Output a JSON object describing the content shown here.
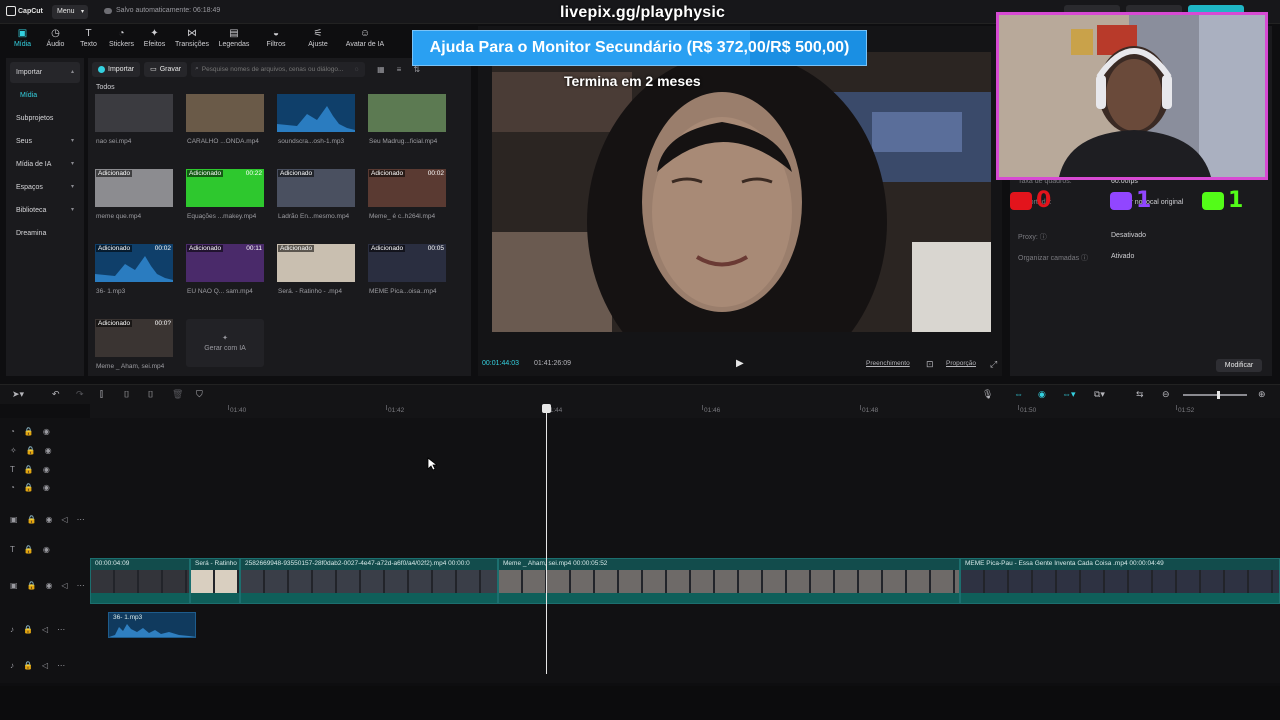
{
  "app": {
    "logo": "CapCut",
    "menu_label": "Menu",
    "autosave": "Salvo automaticamente: 06:18:49"
  },
  "overlay": {
    "stream_url": "livepix.gg/playphysic",
    "goal_text": "Ajuda Para o Monitor Secundário (R$ 372,00/R$ 500,00)",
    "goal_progress": 0.744,
    "goal_subtitle": "Termina em 2 meses",
    "counters": [
      {
        "platform": "youtube-icon",
        "value": "0",
        "color": "#e3141c"
      },
      {
        "platform": "twitch-icon",
        "value": "1",
        "color": "#9146ff"
      },
      {
        "platform": "kick-icon",
        "value": "1",
        "color": "#53fc18"
      }
    ]
  },
  "toolbar": [
    {
      "label": "Mídia",
      "icon": "media-icon",
      "active": true
    },
    {
      "label": "Áudio",
      "icon": "audio-icon"
    },
    {
      "label": "Texto",
      "icon": "text-icon"
    },
    {
      "label": "Stickers",
      "icon": "sticker-icon"
    },
    {
      "label": "Efeitos",
      "icon": "effects-icon"
    },
    {
      "label": "Transições",
      "icon": "transitions-icon"
    },
    {
      "label": "Legendas",
      "icon": "captions-icon"
    },
    {
      "label": "Filtros",
      "icon": "filters-icon"
    },
    {
      "label": "Ajuste",
      "icon": "adjust-icon"
    },
    {
      "label": "Avatar de IA",
      "icon": "ai-avatar-icon"
    }
  ],
  "leftnav": [
    {
      "label": "Importar",
      "chevron": "▴",
      "selected": true
    },
    {
      "label": "Mídia",
      "active": true
    },
    {
      "label": "Subprojetos"
    },
    {
      "label": "Seus",
      "chevron": "▾"
    },
    {
      "label": "Mídia de IA",
      "chevron": "▾"
    },
    {
      "label": "Espaços",
      "chevron": "▾"
    },
    {
      "label": "Biblioteca",
      "chevron": "▾"
    },
    {
      "label": "Dreamina"
    }
  ],
  "media": {
    "import_label": "Importar",
    "record_label": "Gravar",
    "search_placeholder": "Pesquise nomes de arquivos, cenas ou diálogo...",
    "section_label": "Todos",
    "items": [
      {
        "name": "nao sei.mp4",
        "badge": "",
        "duration": "",
        "bg": "#3b3b40"
      },
      {
        "name": "CARALHO ...ONDA.mp4",
        "badge": "",
        "duration": "",
        "bg": "#6a5a48"
      },
      {
        "name": "soundscra...osh-1.mp3",
        "badge": "",
        "duration": "",
        "bg": "#0f4c7c"
      },
      {
        "name": "Seu Madrug...ficial.mp4",
        "badge": "",
        "duration": "",
        "bg": "#5c7a52"
      },
      {
        "name": "meme que.mp4",
        "badge": "Adicionado",
        "duration": "",
        "bg": "#8c8c90"
      },
      {
        "name": "Equações ...makey.mp4",
        "badge": "Adicionado",
        "duration": "00:22",
        "bg": "#2ec82e"
      },
      {
        "name": "Ladrão En...mesmo.mp4",
        "badge": "Adicionado",
        "duration": "",
        "bg": "#4a5060"
      },
      {
        "name": "Meme_ é c..h264l.mp4",
        "badge": "Adicionado",
        "duration": "00:02",
        "bg": "#5a3a32"
      },
      {
        "name": "36- 1.mp3",
        "badge": "Adicionado",
        "duration": "00:02",
        "bg": "#0f4c7c"
      },
      {
        "name": "EU NÃO Q... sam.mp4",
        "badge": "Adicionado",
        "duration": "00:11",
        "bg": "#4a2a6a"
      },
      {
        "name": "Será. - Ratinho - .mp4",
        "badge": "Adicionado",
        "duration": "",
        "bg": "#c9bfb0"
      },
      {
        "name": "MEME Pica...oisa..mp4",
        "badge": "Adicionado",
        "duration": "00:05",
        "bg": "#2a2e40"
      },
      {
        "name": "Meme _ Aham, sei.mp4",
        "badge": "Adicionado",
        "duration": "00:0?",
        "bg": "#3a3432"
      }
    ],
    "ai_generate_label": "Gerar com IA"
  },
  "player": {
    "current_time": "00:01:44:03",
    "total_time": "01:41:26:09",
    "fill_label": "Preenchimento",
    "ratio_label": "Proporção"
  },
  "details": {
    "rows": [
      {
        "key": "Taxa de quadros:",
        "value": "60.00fps"
      },
      {
        "key": "Importada:",
        "value": "Manter no local original"
      },
      {
        "key": "Proxy:",
        "value": "Desativado"
      },
      {
        "key": "Organizar camadas",
        "value": "Ativado"
      }
    ],
    "modify_label": "Modificar"
  },
  "timeline": {
    "ruler_ticks": [
      "01:40",
      "01:42",
      "01:44",
      "01:46",
      "01:48",
      "01:50",
      "01:52"
    ],
    "clips": [
      {
        "label": "00:00:04:09",
        "bg": "#33343a"
      },
      {
        "label": "Será - Ratinho",
        "bg": "#d9cfc0"
      },
      {
        "label": "2582669948-93550157-28f0dab2-0027-4e47-a72d-a6f0/a4/02f2).mp4   00:00:0",
        "bg": "#3a3e48"
      },
      {
        "label": "Meme _ Aham, sei.mp4   00:00:05:52",
        "bg": "#6e6a68"
      },
      {
        "label": "MEME Pica-Pau - Essa Gente Inventa Cada Coisa .mp4   00:00:04:49",
        "bg": "#2e3242"
      }
    ],
    "audio_clip": "36- 1.mp3"
  }
}
